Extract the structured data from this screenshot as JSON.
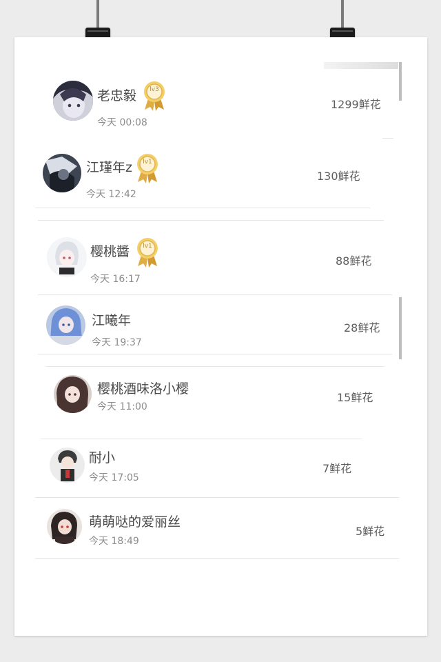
{
  "ranking": [
    {
      "name": "老忠毅",
      "time": "今天 00:08",
      "flowers": "1299鲜花",
      "badge": "lv3",
      "avatar_icon": "anime-boy-avatar"
    },
    {
      "name": "江瑾年z",
      "time": "今天 12:42",
      "flowers": "130鲜花",
      "badge": "lv1",
      "avatar_icon": "dark-anime-avatar"
    },
    {
      "name": "樱桃醬",
      "time": "今天 16:17",
      "flowers": "88鲜花",
      "badge": "lv1",
      "avatar_icon": "white-hair-girl-avatar"
    },
    {
      "name": "江曦年",
      "time": "今天 19:37",
      "flowers": "28鲜花",
      "badge": "",
      "avatar_icon": "blue-hair-girl-avatar"
    },
    {
      "name": "樱桃酒味洛小樱",
      "time": "今天 11:00",
      "flowers": "15鲜花",
      "badge": "",
      "avatar_icon": "brown-hair-girl-avatar"
    },
    {
      "name": "耐小",
      "time": "今天 17:05",
      "flowers": "7鲜花",
      "badge": "",
      "avatar_icon": "chibi-boy-avatar"
    },
    {
      "name": "萌萌哒的爱丽丝",
      "time": "今天 18:49",
      "flowers": "5鲜花",
      "badge": "",
      "avatar_icon": "dark-hair-girl-avatar"
    }
  ],
  "colors": {
    "background": "#ececec",
    "paper": "#ffffff",
    "badge_gold": "#e2b34a",
    "text": "#4a4a4a",
    "subtext": "#8c8c8c"
  }
}
